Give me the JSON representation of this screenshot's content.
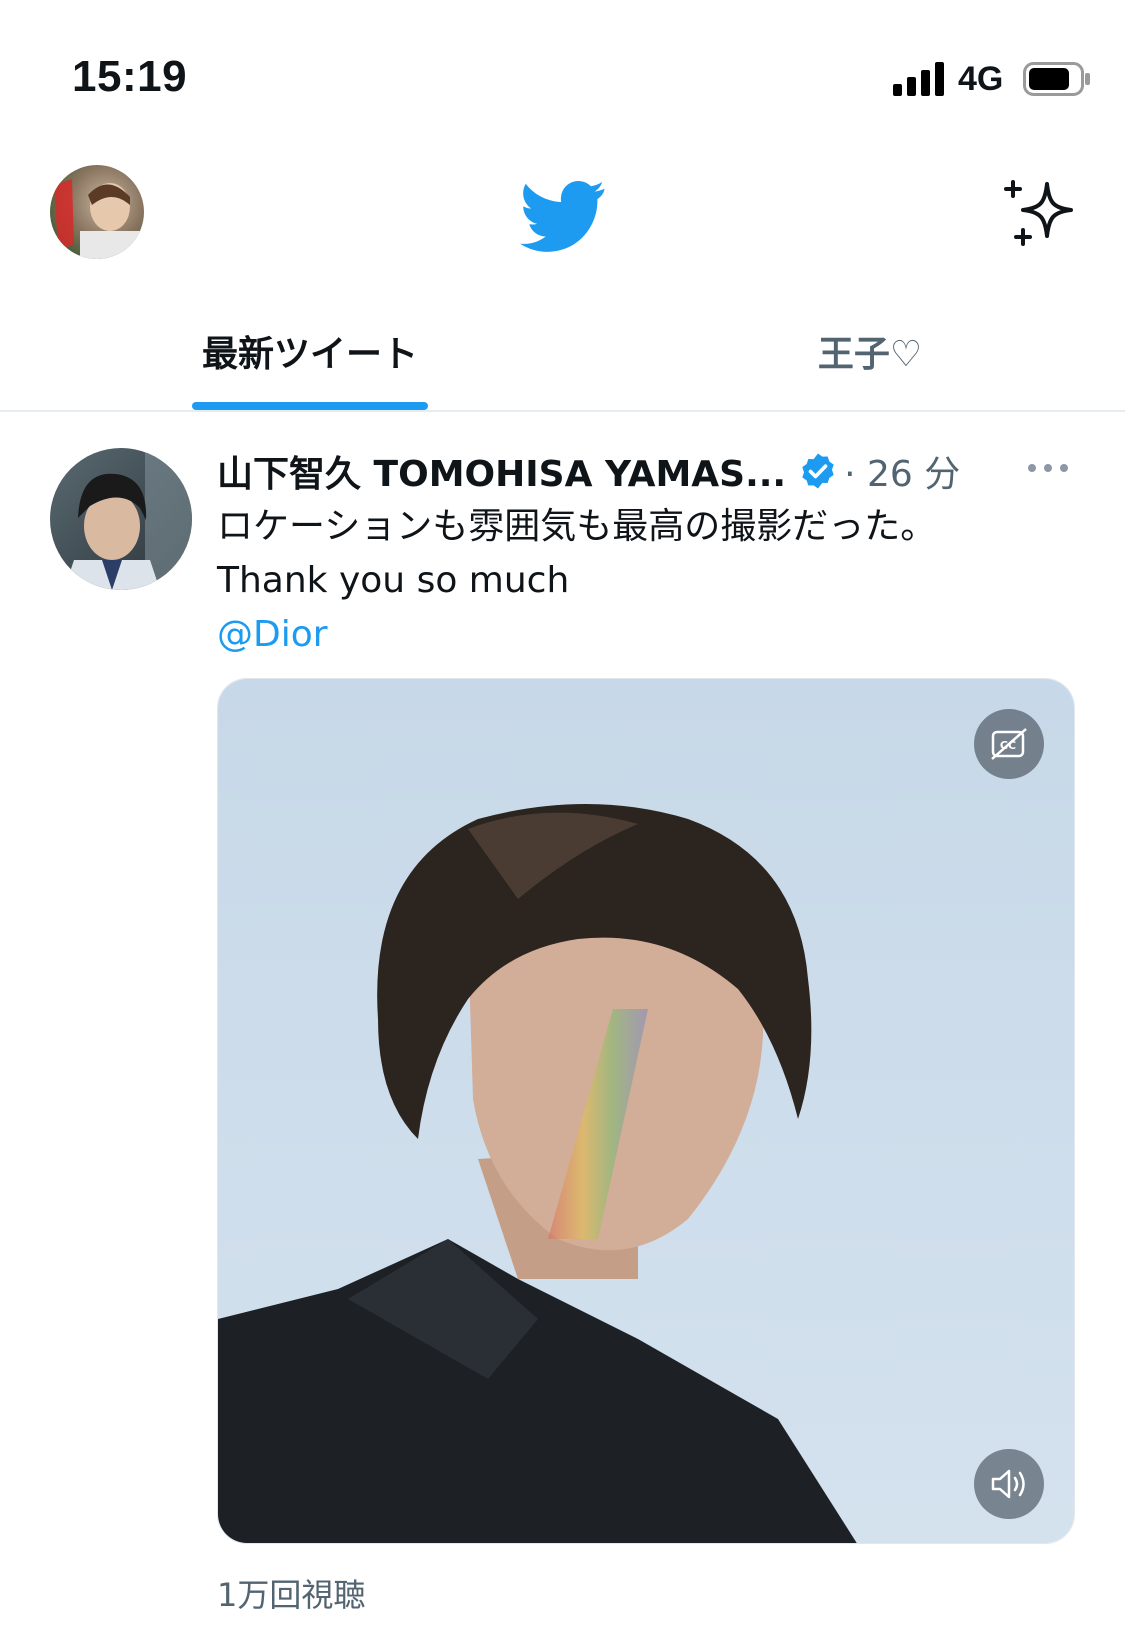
{
  "status_bar": {
    "time": "15:19",
    "network": "4G",
    "icons": [
      "signal-bars-icon",
      "battery-icon"
    ]
  },
  "header": {
    "logo": "twitter-bird-icon",
    "right_icon": "sparkle-icon",
    "brand_color": "#1d9bf0"
  },
  "tabs": [
    {
      "label": "最新ツイート",
      "selected": true
    },
    {
      "label": "王子♡",
      "selected": false
    }
  ],
  "tweet": {
    "author_name": "山下智久 TOMOHISA YAMAS...",
    "verified": true,
    "time_ago": "· 26 分",
    "text_lines": [
      "ロケーションも雰囲気も最高の撮影だった。",
      "Thank you so much"
    ],
    "mention": "@Dior",
    "media_controls": [
      "closed-captions-icon",
      "volume-icon"
    ],
    "views": "1万回視聴"
  }
}
